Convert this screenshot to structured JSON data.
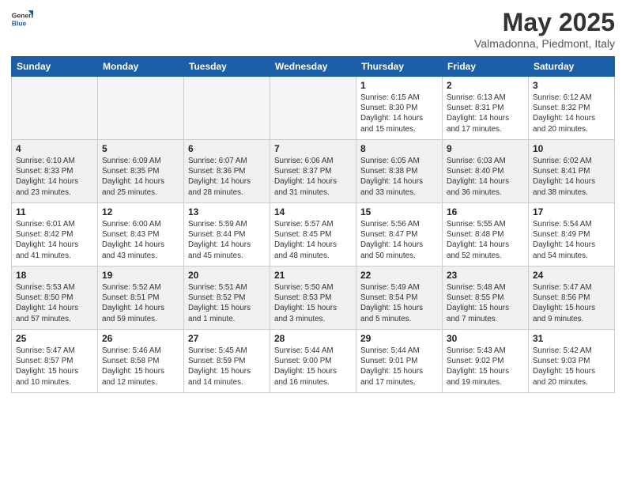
{
  "header": {
    "logo_general": "General",
    "logo_blue": "Blue",
    "month": "May 2025",
    "location": "Valmadonna, Piedmont, Italy"
  },
  "days_of_week": [
    "Sunday",
    "Monday",
    "Tuesday",
    "Wednesday",
    "Thursday",
    "Friday",
    "Saturday"
  ],
  "weeks": [
    [
      {
        "day": "",
        "info": "",
        "empty": true
      },
      {
        "day": "",
        "info": "",
        "empty": true
      },
      {
        "day": "",
        "info": "",
        "empty": true
      },
      {
        "day": "",
        "info": "",
        "empty": true
      },
      {
        "day": "1",
        "info": "Sunrise: 6:15 AM\nSunset: 8:30 PM\nDaylight: 14 hours\nand 15 minutes."
      },
      {
        "day": "2",
        "info": "Sunrise: 6:13 AM\nSunset: 8:31 PM\nDaylight: 14 hours\nand 17 minutes."
      },
      {
        "day": "3",
        "info": "Sunrise: 6:12 AM\nSunset: 8:32 PM\nDaylight: 14 hours\nand 20 minutes."
      }
    ],
    [
      {
        "day": "4",
        "info": "Sunrise: 6:10 AM\nSunset: 8:33 PM\nDaylight: 14 hours\nand 23 minutes."
      },
      {
        "day": "5",
        "info": "Sunrise: 6:09 AM\nSunset: 8:35 PM\nDaylight: 14 hours\nand 25 minutes."
      },
      {
        "day": "6",
        "info": "Sunrise: 6:07 AM\nSunset: 8:36 PM\nDaylight: 14 hours\nand 28 minutes."
      },
      {
        "day": "7",
        "info": "Sunrise: 6:06 AM\nSunset: 8:37 PM\nDaylight: 14 hours\nand 31 minutes."
      },
      {
        "day": "8",
        "info": "Sunrise: 6:05 AM\nSunset: 8:38 PM\nDaylight: 14 hours\nand 33 minutes."
      },
      {
        "day": "9",
        "info": "Sunrise: 6:03 AM\nSunset: 8:40 PM\nDaylight: 14 hours\nand 36 minutes."
      },
      {
        "day": "10",
        "info": "Sunrise: 6:02 AM\nSunset: 8:41 PM\nDaylight: 14 hours\nand 38 minutes."
      }
    ],
    [
      {
        "day": "11",
        "info": "Sunrise: 6:01 AM\nSunset: 8:42 PM\nDaylight: 14 hours\nand 41 minutes."
      },
      {
        "day": "12",
        "info": "Sunrise: 6:00 AM\nSunset: 8:43 PM\nDaylight: 14 hours\nand 43 minutes."
      },
      {
        "day": "13",
        "info": "Sunrise: 5:59 AM\nSunset: 8:44 PM\nDaylight: 14 hours\nand 45 minutes."
      },
      {
        "day": "14",
        "info": "Sunrise: 5:57 AM\nSunset: 8:45 PM\nDaylight: 14 hours\nand 48 minutes."
      },
      {
        "day": "15",
        "info": "Sunrise: 5:56 AM\nSunset: 8:47 PM\nDaylight: 14 hours\nand 50 minutes."
      },
      {
        "day": "16",
        "info": "Sunrise: 5:55 AM\nSunset: 8:48 PM\nDaylight: 14 hours\nand 52 minutes."
      },
      {
        "day": "17",
        "info": "Sunrise: 5:54 AM\nSunset: 8:49 PM\nDaylight: 14 hours\nand 54 minutes."
      }
    ],
    [
      {
        "day": "18",
        "info": "Sunrise: 5:53 AM\nSunset: 8:50 PM\nDaylight: 14 hours\nand 57 minutes."
      },
      {
        "day": "19",
        "info": "Sunrise: 5:52 AM\nSunset: 8:51 PM\nDaylight: 14 hours\nand 59 minutes."
      },
      {
        "day": "20",
        "info": "Sunrise: 5:51 AM\nSunset: 8:52 PM\nDaylight: 15 hours\nand 1 minute."
      },
      {
        "day": "21",
        "info": "Sunrise: 5:50 AM\nSunset: 8:53 PM\nDaylight: 15 hours\nand 3 minutes."
      },
      {
        "day": "22",
        "info": "Sunrise: 5:49 AM\nSunset: 8:54 PM\nDaylight: 15 hours\nand 5 minutes."
      },
      {
        "day": "23",
        "info": "Sunrise: 5:48 AM\nSunset: 8:55 PM\nDaylight: 15 hours\nand 7 minutes."
      },
      {
        "day": "24",
        "info": "Sunrise: 5:47 AM\nSunset: 8:56 PM\nDaylight: 15 hours\nand 9 minutes."
      }
    ],
    [
      {
        "day": "25",
        "info": "Sunrise: 5:47 AM\nSunset: 8:57 PM\nDaylight: 15 hours\nand 10 minutes."
      },
      {
        "day": "26",
        "info": "Sunrise: 5:46 AM\nSunset: 8:58 PM\nDaylight: 15 hours\nand 12 minutes."
      },
      {
        "day": "27",
        "info": "Sunrise: 5:45 AM\nSunset: 8:59 PM\nDaylight: 15 hours\nand 14 minutes."
      },
      {
        "day": "28",
        "info": "Sunrise: 5:44 AM\nSunset: 9:00 PM\nDaylight: 15 hours\nand 16 minutes."
      },
      {
        "day": "29",
        "info": "Sunrise: 5:44 AM\nSunset: 9:01 PM\nDaylight: 15 hours\nand 17 minutes."
      },
      {
        "day": "30",
        "info": "Sunrise: 5:43 AM\nSunset: 9:02 PM\nDaylight: 15 hours\nand 19 minutes."
      },
      {
        "day": "31",
        "info": "Sunrise: 5:42 AM\nSunset: 9:03 PM\nDaylight: 15 hours\nand 20 minutes."
      }
    ]
  ]
}
